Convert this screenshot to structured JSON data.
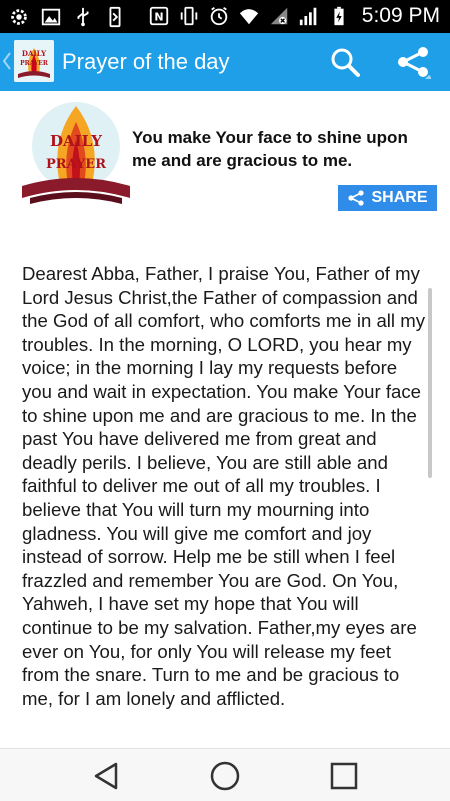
{
  "status_bar": {
    "time": "5:09 PM",
    "icons": [
      "settings-icon",
      "image-icon",
      "usb-icon",
      "phone-icon",
      "nfc-icon",
      "vibrate-icon",
      "alarm-icon",
      "wifi-icon",
      "no-sim-icon",
      "signal-icon",
      "battery-charging-icon"
    ]
  },
  "app_bar": {
    "title": "Prayer of the day",
    "logo_text": [
      "DAILY",
      "PRAYER"
    ],
    "actions": [
      "search-icon",
      "share-icon"
    ]
  },
  "header": {
    "logo_text": [
      "DAILY",
      "PRAYER"
    ],
    "headline": "You make Your face to shine upon me and are gracious to me.",
    "share_label": "SHARE"
  },
  "prayer": {
    "body": "Dearest Abba, Father, I praise You, Father of my Lord Jesus Christ,the Father of compassion and the God of all comfort, who comforts me in all my troubles. In the morning, O LORD, you hear my voice; in the morning I lay my requests before you and wait in expectation. You make Your face to shine upon me and are gracious to me. In the past You have delivered me from great and deadly perils. I believe, You are still able and faithful to deliver me out of all my troubles. I believe that You will turn my mourning into gladness. You will give me comfort and joy instead of sorrow. Help me be still when I feel frazzled and remember You are God. On You, Yahweh, I have set my hope that You will continue to be my salvation. Father,my eyes are ever on You, for only You will release my feet from the snare. Turn to me and be gracious to me, for I am lonely and afflicted."
  },
  "nav_bar": {
    "buttons": [
      "back-icon",
      "home-icon",
      "recents-icon"
    ]
  },
  "colors": {
    "app_bar": "#1e9fe8",
    "share_button": "#2f8ce8",
    "status_bar": "#000000",
    "nav_bar": "#f7f7f7"
  }
}
